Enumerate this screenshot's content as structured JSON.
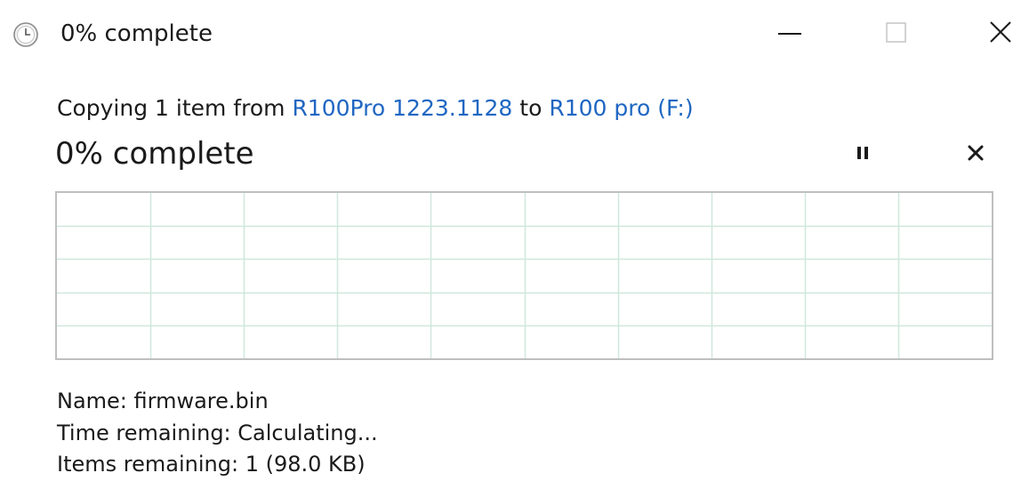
{
  "window": {
    "title": "0% complete",
    "icon": "clock-icon"
  },
  "titlebar_buttons": {
    "minimize": "minimize-icon",
    "maximize": "maximize-icon",
    "close": "close-icon"
  },
  "copy": {
    "prefix": "Copying 1 item from",
    "source": "R100Pro 1223.1128",
    "to_word": "to",
    "destination": "R100 pro (F:)"
  },
  "progress": {
    "label": "0% complete",
    "percent": 0,
    "pause_icon": "pause-icon",
    "cancel_icon": "cancel-icon"
  },
  "details": {
    "name_label": "Name:",
    "name_value": "firmware.bin",
    "time_label": "Time remaining:",
    "time_value": "Calculating...",
    "items_label": "Items remaining:",
    "items_value": "1 (98.0 KB)"
  },
  "colors": {
    "link": "#1f66c2",
    "grid_line": "#cfe8dc",
    "graph_border": "#bfbfbf"
  }
}
